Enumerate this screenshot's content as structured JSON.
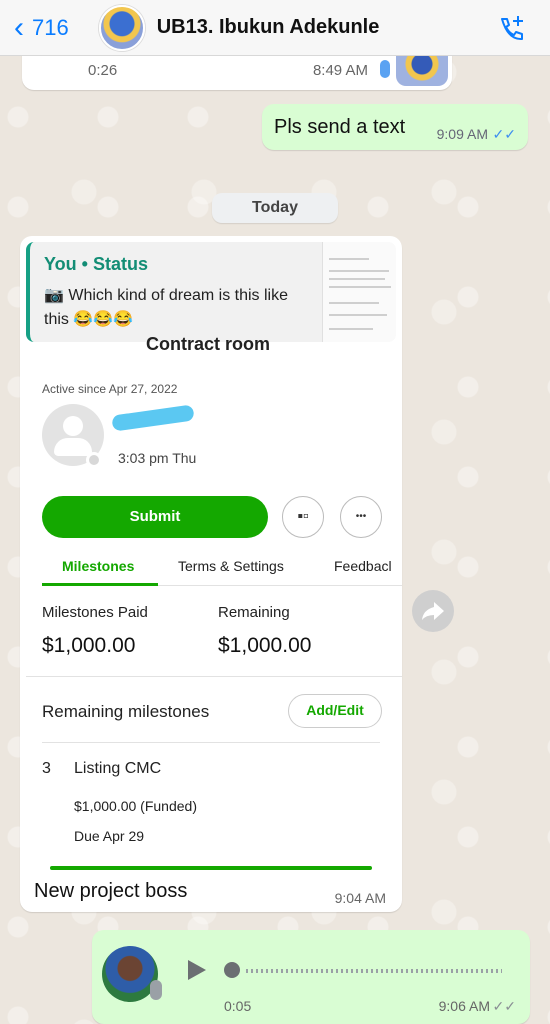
{
  "header": {
    "back_count": "716",
    "contact_name": "UB13. Ibukun Adekunle"
  },
  "messages": {
    "prev_voice": {
      "duration": "0:26",
      "time": "8:49 AM"
    },
    "text_out": {
      "text": "Pls send a text",
      "time": "9:09 AM"
    },
    "date_separator": "Today",
    "status_reply": {
      "quote_author": "You • Status",
      "quote_text": "Which kind of dream is this like this 😂😂😂",
      "caption": "New project boss",
      "time": "9:04 AM"
    },
    "voice_out": {
      "duration": "0:05",
      "time": "9:06 AM"
    }
  },
  "screenshot": {
    "title_cut": "Contract room",
    "active_since": "Active since Apr 27, 2022",
    "last_seen": "3:03 pm Thu",
    "submit_label": "Submit",
    "more_label": "•••",
    "tabs": [
      "Milestones",
      "Terms & Settings",
      "Feedbacl"
    ],
    "milestones_paid_label": "Milestones Paid",
    "milestones_paid_value": "$1,000.00",
    "remaining_label": "Remaining",
    "remaining_value": "$1,000.00",
    "remaining_milestones_label": "Remaining milestones",
    "add_edit_label": "Add/Edit",
    "milestone": {
      "number": "3",
      "name": "Listing CMC",
      "amount": "$1,000.00 (Funded)",
      "due": "Due Apr 29"
    }
  },
  "colors": {
    "ios_blue": "#0a7cff",
    "whatsapp_out": "#d9fdd3",
    "upwork_green": "#14a800",
    "quote_teal": "#138d75"
  }
}
